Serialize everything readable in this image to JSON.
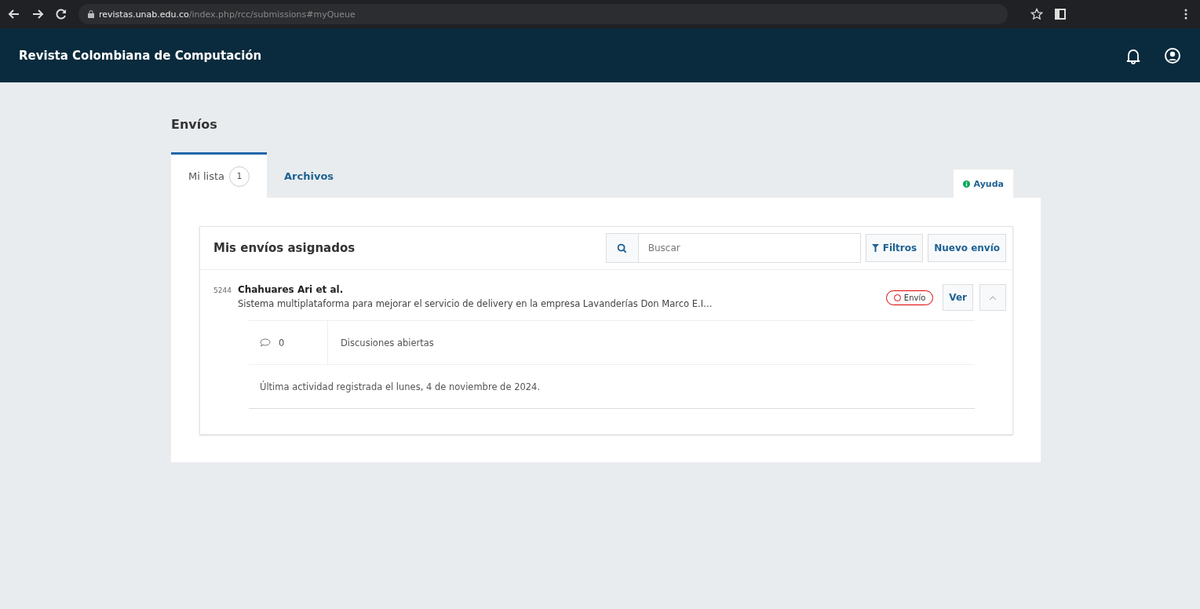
{
  "browser": {
    "url_host": "revistas.unab.edu.co",
    "url_path": "/index.php/rcc/submissions#myQueue"
  },
  "header": {
    "title": "Revista Colombiana de Computación"
  },
  "page_title": "Envíos",
  "tabs": [
    {
      "label": "Mi lista",
      "count": "1",
      "selected": true
    },
    {
      "label": "Archivos",
      "selected": false
    }
  ],
  "help": "Ayuda",
  "list": {
    "title": "Mis envíos asignados",
    "search": {
      "placeholder": "Buscar"
    },
    "filters": "Filtros",
    "new_button": "Nuevo envío",
    "items": [
      {
        "id": "5244",
        "authors": "Chahuares Ari et al.",
        "title": "Sistema multiplataforma para mejorar el servicio de delivery en la empresa Lavanderías Don Marco E.I…",
        "stage": "Envío",
        "view": "Ver",
        "expanded": true,
        "discussions_count": "0",
        "discussions_label": "Discusiones abiertas",
        "last_activity": "Última actividad registrada el lunes, 4 de noviembre de 2024."
      }
    ]
  }
}
